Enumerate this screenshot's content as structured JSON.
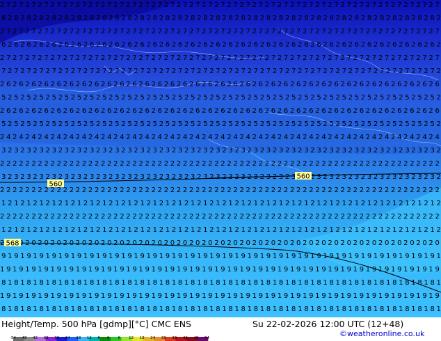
{
  "map": {
    "contour_labels": [
      "560",
      "560",
      "568"
    ],
    "field_values_by_band": [
      "27",
      "28",
      "27",
      "26",
      "27",
      "27",
      "26",
      "25",
      "26",
      "25",
      "24",
      "23",
      "22",
      "23",
      "22",
      "21",
      "22",
      "21",
      "20",
      "19",
      "19",
      "18",
      "19",
      "18"
    ],
    "colors": {
      "deep_blue": "#0a10b4",
      "mid_blue": "#2858e0",
      "sky_blue": "#2ea2f0",
      "light_blue": "#3cc0ff",
      "contour_line": "#000000",
      "contour_label_bg": "#ffff9a",
      "coastline": "#c8d8ff"
    }
  },
  "footer": {
    "title": "Height/Temp. 500 hPa [gdmp][°C] CMC ENS",
    "datetime": "Su 22-02-2026 12:00 UTC (12+48)",
    "credit": "©weatheronline.co.uk",
    "legend_ticks": [
      "-54",
      "-48",
      "-42",
      "-38",
      "-30",
      "-24",
      "-18",
      "-12",
      "-6",
      "0",
      "6",
      "12",
      "18",
      "24",
      "30",
      "36",
      "42",
      "48",
      "54"
    ],
    "legend_colors": [
      "#6d6d6d",
      "#8c8c8c",
      "#b46ee6",
      "#8c28d2",
      "#1c1ccc",
      "#1c64ff",
      "#3cb4ff",
      "#00b4b4",
      "#0a8c0a",
      "#28c828",
      "#96e628",
      "#e6e628",
      "#e6b428",
      "#e68c28",
      "#dc3c1e",
      "#b4141e",
      "#8c0a1e",
      "#6e0a6e"
    ]
  }
}
